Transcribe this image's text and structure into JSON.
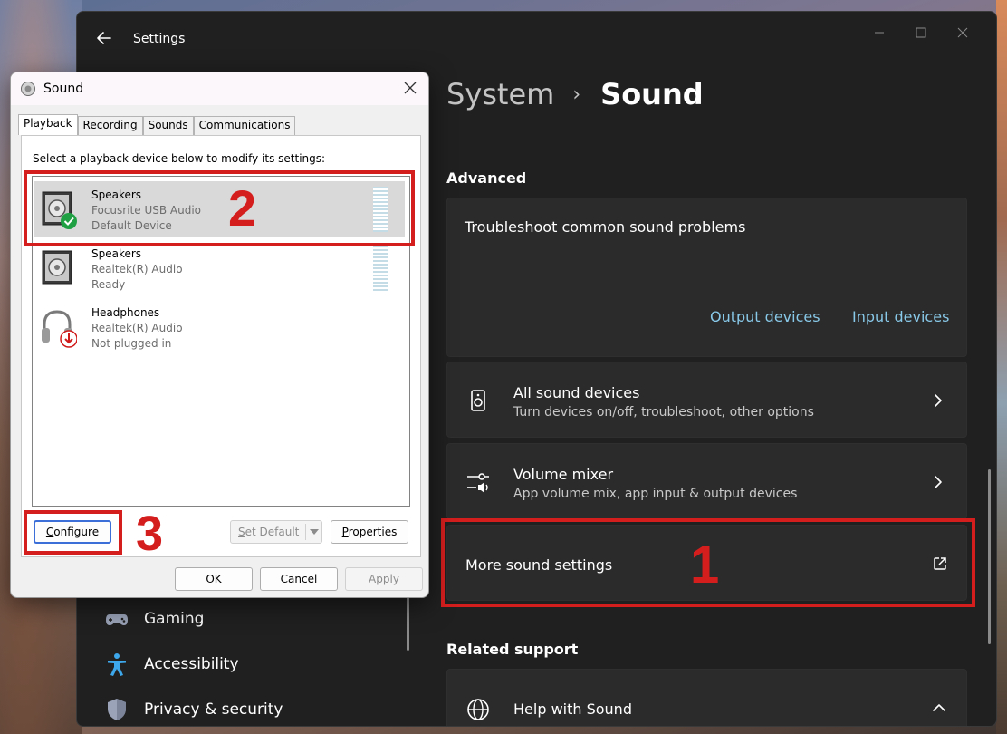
{
  "settings": {
    "window_title": "Settings",
    "breadcrumb": {
      "parent": "System",
      "separator": "›",
      "current": "Sound"
    },
    "advanced_label": "Advanced",
    "troubleshoot": {
      "title": "Troubleshoot common sound problems",
      "output_link": "Output devices",
      "input_link": "Input devices"
    },
    "rows": [
      {
        "title": "All sound devices",
        "subtitle": "Turn devices on/off, troubleshoot, other options",
        "icon": "speaker-icon"
      },
      {
        "title": "Volume mixer",
        "subtitle": "App volume mix, app input & output devices",
        "icon": "mixer-icon"
      }
    ],
    "more_sound_settings": "More sound settings",
    "related_support_label": "Related support",
    "help_with_sound": "Help with Sound",
    "nav": [
      {
        "label": "Gaming",
        "icon": "gamepad-icon"
      },
      {
        "label": "Accessibility",
        "icon": "accessibility-icon"
      },
      {
        "label": "Privacy & security",
        "icon": "shield-icon"
      }
    ]
  },
  "dialog": {
    "title": "Sound",
    "tabs": [
      "Playback",
      "Recording",
      "Sounds",
      "Communications"
    ],
    "instruction": "Select a playback device below to modify its settings:",
    "devices": [
      {
        "name": "Speakers",
        "line1": "Focusrite USB Audio",
        "line2": "Default Device",
        "status_icon": "check-icon"
      },
      {
        "name": "Speakers",
        "line1": "Realtek(R) Audio",
        "line2": "Ready"
      },
      {
        "name": "Headphones",
        "line1": "Realtek(R) Audio",
        "line2": "Not plugged in",
        "status_icon": "unplugged-arrow-icon"
      }
    ],
    "buttons": {
      "configure": "Configure",
      "set_default": "Set Default",
      "properties": "Properties",
      "ok": "OK",
      "cancel": "Cancel",
      "apply": "Apply"
    }
  },
  "annotations": [
    "1",
    "2",
    "3"
  ],
  "colors": {
    "settings_bg": "#202020",
    "card_bg": "#2b2b2b",
    "link": "#88c8e8",
    "annotation_red": "#d41e1e"
  }
}
